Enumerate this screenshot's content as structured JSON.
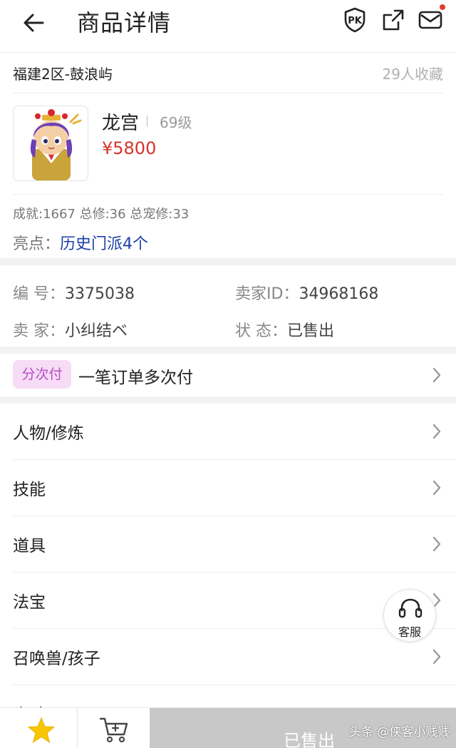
{
  "header": {
    "title": "商品详情"
  },
  "product": {
    "server": "福建2区-鼓浪屿",
    "favorites": "29人收藏",
    "name": "龙宫",
    "level": "69级",
    "price": "¥5800",
    "stats": "成就:1667 总修:36 总宠修:33",
    "highlight_label": "亮点：",
    "highlight_value": "历史门派4个"
  },
  "info": {
    "id_label": "编  号：",
    "id_value": "3375038",
    "seller_id_label": "卖家ID：",
    "seller_id_value": "34968168",
    "seller_label": "卖  家：",
    "seller_value": "小纠结ベ",
    "status_label": "状  态：",
    "status_value": "已售出"
  },
  "payment": {
    "tag": "分次付",
    "text": "一笔订单多次付"
  },
  "menu": [
    {
      "label": "人物/修炼"
    },
    {
      "label": "技能"
    },
    {
      "label": "道具"
    },
    {
      "label": "法宝"
    },
    {
      "label": "召唤兽/孩子"
    },
    {
      "label": "坐骑"
    }
  ],
  "service": {
    "label": "客服"
  },
  "bottom_bar": {
    "sold_label": "已售出"
  },
  "watermark": "头条 @侠客小贱贱",
  "colors": {
    "price": "#d9322c",
    "highlight": "#1c3fa8",
    "tag_bg": "#f6dcf5",
    "star": "#f7c600",
    "sold_bg": "#c8c8c8"
  },
  "icons": [
    "back-arrow-icon",
    "pk-icon",
    "share-icon",
    "mail-icon",
    "chevron-right-icon",
    "headset-icon",
    "star-icon",
    "cart-icon"
  ]
}
